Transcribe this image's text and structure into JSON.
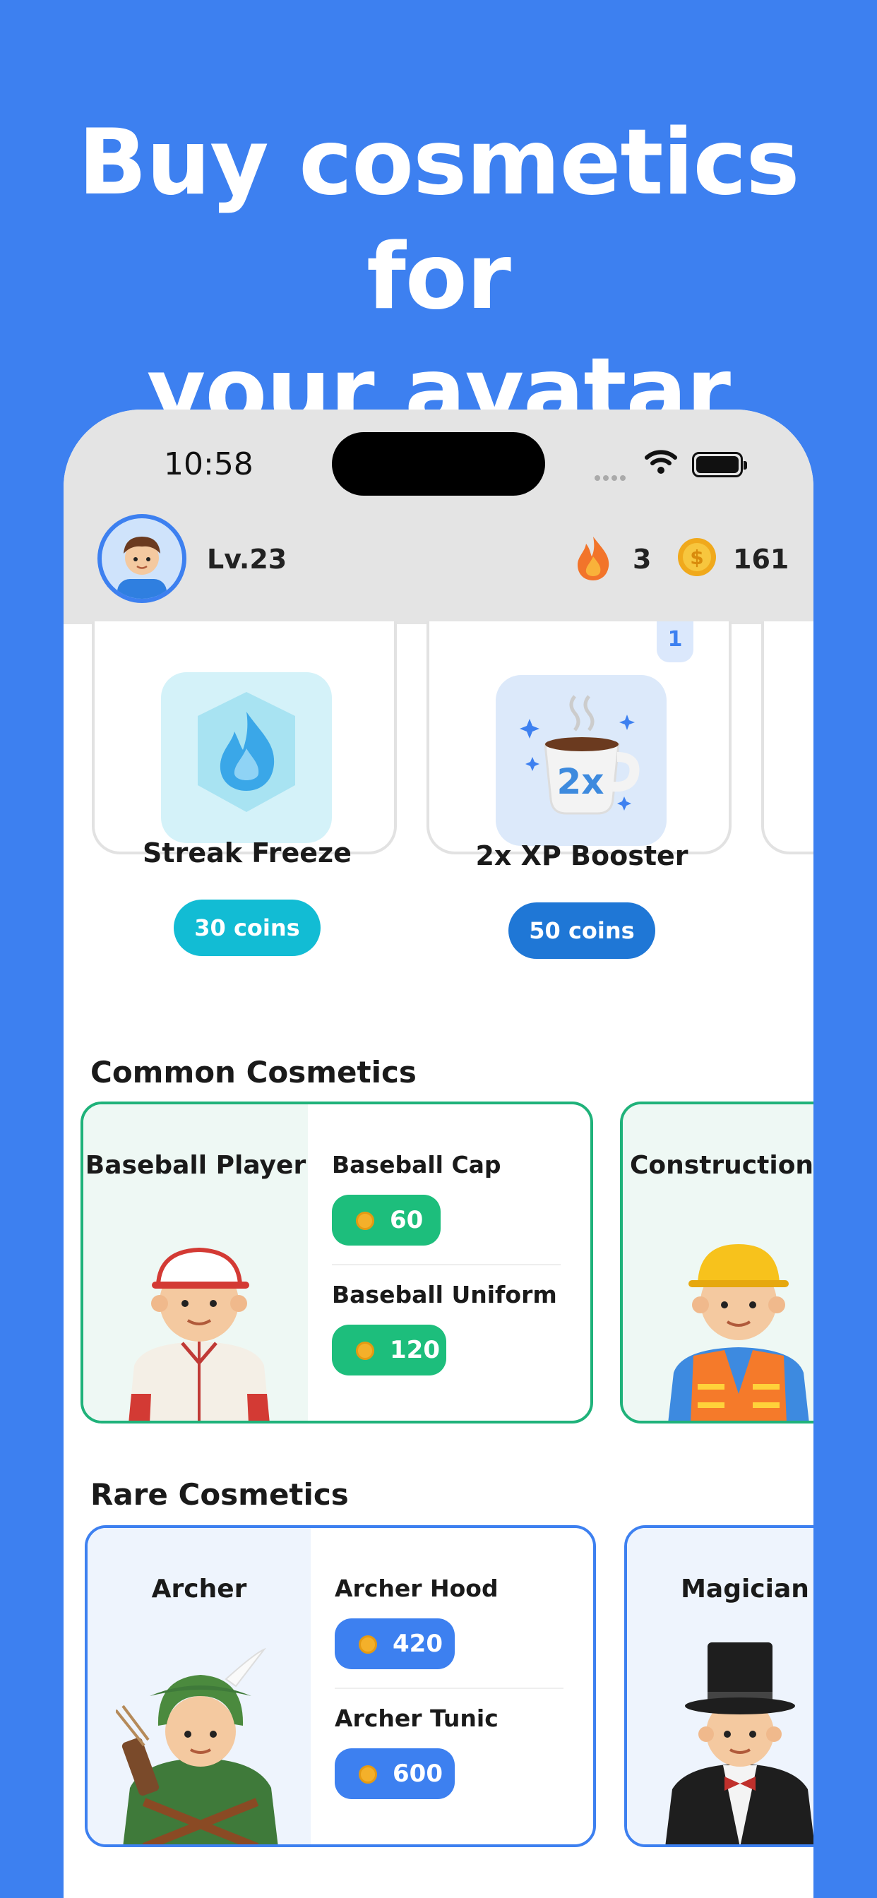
{
  "headline": {
    "line1": "Buy cosmetics for",
    "line2": "your avatar"
  },
  "status_bar": {
    "time": "10:58"
  },
  "header": {
    "level": "Lv.23",
    "streak": "3",
    "coins": "161"
  },
  "powerups": [
    {
      "name": "Streak Freeze",
      "price": "30 coins"
    },
    {
      "name": "2x XP Booster",
      "price": "50 coins",
      "quantity": "1",
      "icon_text": "2x"
    }
  ],
  "sections": {
    "common": {
      "title": "Common Cosmetics",
      "sets": [
        {
          "name": "Baseball Player",
          "items": [
            {
              "name": "Baseball Cap",
              "price": "60"
            },
            {
              "name": "Baseball Uniform",
              "price": "120"
            }
          ]
        },
        {
          "name": "Construction W"
        }
      ]
    },
    "rare": {
      "title": "Rare Cosmetics",
      "sets": [
        {
          "name": "Archer",
          "items": [
            {
              "name": "Archer Hood",
              "price": "420"
            },
            {
              "name": "Archer Tunic",
              "price": "600"
            }
          ]
        },
        {
          "name": "Magician"
        }
      ]
    }
  },
  "colors": {
    "background": "#3d80f0",
    "common_border": "#1fb27a",
    "common_button": "#1dbe7c",
    "rare_border": "#3d80f0",
    "rare_button": "#3d80f0",
    "streak_button": "#12bcd4",
    "xp_button": "#1f77d6"
  }
}
